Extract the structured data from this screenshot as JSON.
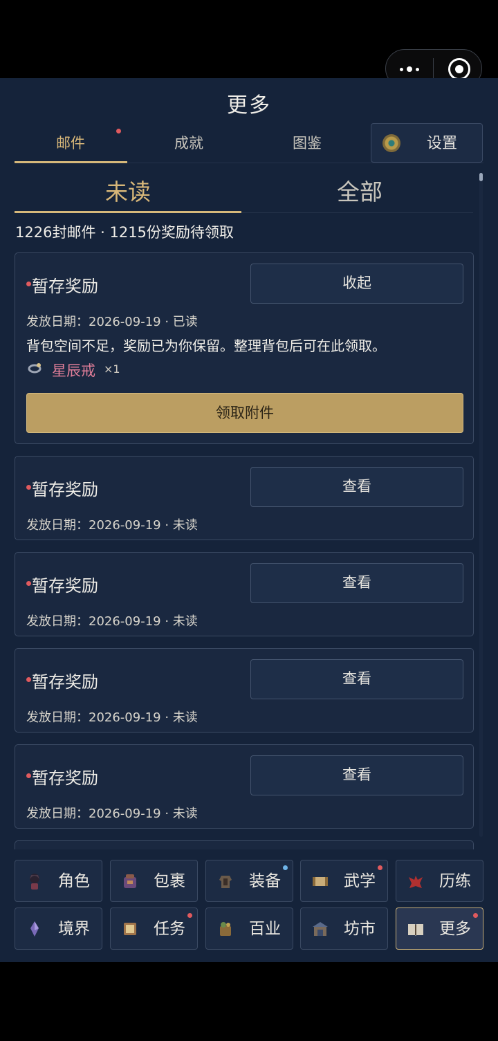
{
  "page": {
    "title": "更多"
  },
  "tabs": [
    {
      "label": "邮件",
      "active": true,
      "has_dot": true
    },
    {
      "label": "成就",
      "active": false,
      "has_dot": false
    },
    {
      "label": "图鉴",
      "active": false,
      "has_dot": false
    }
  ],
  "settings": {
    "label": "设置",
    "icon": "gear-icon"
  },
  "subtabs": [
    {
      "label": "未读",
      "active": true
    },
    {
      "label": "全部",
      "active": false
    }
  ],
  "summary": "1226封邮件 · 1215份奖励待领取",
  "mails": [
    {
      "title": "暂存奖励",
      "action": "收起",
      "meta": "发放日期：2026-09-19 · 已读",
      "expanded": true,
      "body": "背包空间不足，奖励已为你保留。整理背包后可在此领取。",
      "attachment": {
        "name": "星辰戒",
        "qty": "×1",
        "icon": "ring-icon"
      },
      "claim_label": "领取附件"
    },
    {
      "title": "暂存奖励",
      "action": "查看",
      "meta": "发放日期：2026-09-19 · 未读"
    },
    {
      "title": "暂存奖励",
      "action": "查看",
      "meta": "发放日期：2026-09-19 · 未读"
    },
    {
      "title": "暂存奖励",
      "action": "查看",
      "meta": "发放日期：2026-09-19 · 未读"
    },
    {
      "title": "暂存奖励",
      "action": "查看",
      "meta": "发放日期：2026-09-19 · 未读"
    }
  ],
  "nav": [
    {
      "label": "角色",
      "icon": "character-icon",
      "dot": ""
    },
    {
      "label": "包裹",
      "icon": "bag-icon",
      "dot": ""
    },
    {
      "label": "装备",
      "icon": "armor-icon",
      "dot": "blue"
    },
    {
      "label": "武学",
      "icon": "scroll-icon",
      "dot": "red"
    },
    {
      "label": "历练",
      "icon": "dragon-icon",
      "dot": ""
    },
    {
      "label": "境界",
      "icon": "crystal-icon",
      "dot": ""
    },
    {
      "label": "任务",
      "icon": "quest-icon",
      "dot": "red"
    },
    {
      "label": "百业",
      "icon": "craft-icon",
      "dot": ""
    },
    {
      "label": "坊市",
      "icon": "market-icon",
      "dot": ""
    },
    {
      "label": "更多",
      "icon": "book-icon",
      "dot": "red",
      "active": true
    }
  ],
  "colors": {
    "accent": "#d6b87a",
    "background": "#15233a",
    "badge": "#e05a5e",
    "claim_button": "#bb9e62"
  }
}
